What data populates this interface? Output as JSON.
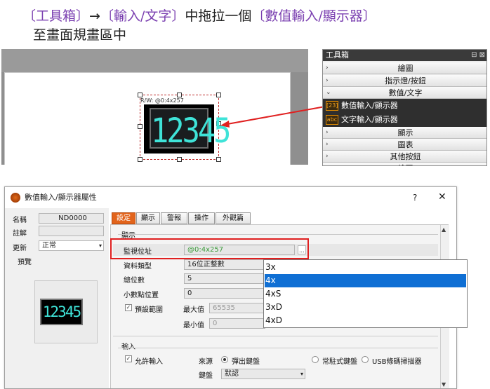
{
  "instruction": {
    "line1": [
      {
        "t": "〔工具箱〕",
        "c": "p"
      },
      {
        "t": "→",
        "c": "k"
      },
      {
        "t": "〔輸入/文字〕",
        "c": "p"
      },
      {
        "t": "中拖拉一個",
        "c": "k"
      },
      {
        "t": "〔數值輸入/顯示器〕",
        "c": "p"
      }
    ],
    "line2": "至畫面規畫區中"
  },
  "canvas": {
    "rw_label": "R/W: @0:4x257",
    "digits": "12345"
  },
  "toolbox": {
    "title": "工具箱",
    "pin": "⊟ ⊠",
    "rows_top": [
      {
        "label": "繪圖",
        "chev": "›"
      },
      {
        "label": "指示燈/按鈕",
        "chev": "›"
      },
      {
        "label": "數值/文字",
        "chev": "⌄"
      }
    ],
    "subitems": [
      {
        "icon": "[23]",
        "label": "數值輸入/顯示器"
      },
      {
        "icon": "abc",
        "label": "文字輸入/顯示器"
      }
    ],
    "rows_bottom": [
      {
        "label": "顯示",
        "chev": "›"
      },
      {
        "label": "圖表",
        "chev": "›"
      },
      {
        "label": "其他按鈕",
        "chev": "›"
      },
      {
        "label": "繪圖",
        "chev": "›"
      }
    ]
  },
  "dialog": {
    "title": "數值輸入/顯示器屬性",
    "help": "?",
    "close": "✕",
    "left": {
      "name_label": "名稱",
      "name_value": "ND0000",
      "comment_label": "註解",
      "comment_value": "",
      "update_label": "更新",
      "update_value": "正常",
      "preview_label": "預覽",
      "preview_digits": "12345"
    },
    "tabs": [
      "設定",
      "顯示",
      "警報",
      "操作",
      "外觀篇"
    ],
    "display_group": "顯示",
    "monitor_label": "監視位址",
    "monitor_value": "@0:4x257",
    "browse_btn": "...",
    "datatype_label": "資料類型",
    "datatype_value": "16位正整數",
    "digits_label": "總位數",
    "digits_value": "5",
    "decimal_label": "小數點位置",
    "decimal_value": "0",
    "range_check": "✓",
    "range_label": "預設範圍",
    "max_label": "最大值",
    "max_value": "65535",
    "min_label": "最小值",
    "min_value": "0",
    "input_group": "輸入",
    "allow_check": "✓",
    "allow_label": "允許輸入",
    "source_label": "來源",
    "source_opts": [
      "彈出鍵盤",
      "常駐式鍵盤",
      "USB條碼掃描器"
    ],
    "keyboard_label": "鍵盤",
    "keyboard_value": "默認",
    "dropdown_options": [
      "3x",
      "4x",
      "4xS",
      "3xD",
      "4xD"
    ],
    "dropdown_selected": "4x"
  },
  "colors": {
    "accent": "#e2641c",
    "highlight": "#e02020",
    "select": "#0f6fd4",
    "digits": "#3fe3d8",
    "purple": "#7a3fb0"
  }
}
